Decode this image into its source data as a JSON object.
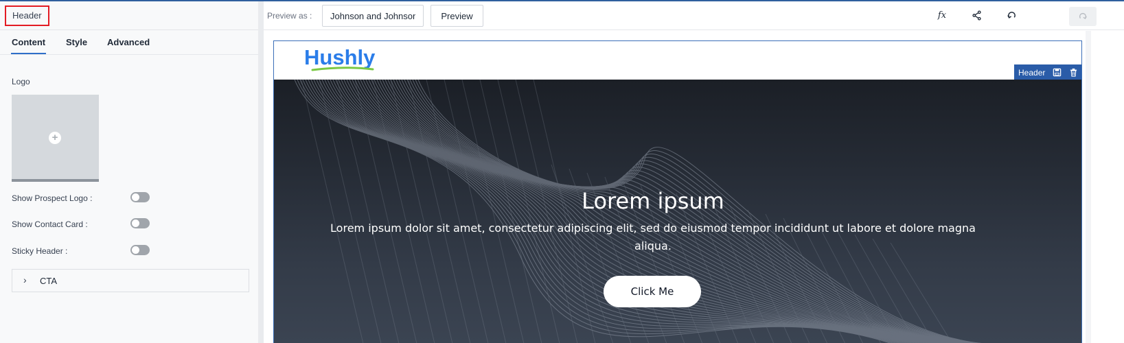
{
  "panel": {
    "title": "Header",
    "tabs": [
      {
        "label": "Content",
        "active": true
      },
      {
        "label": "Style",
        "active": false
      },
      {
        "label": "Advanced",
        "active": false
      }
    ],
    "logo_label": "Logo",
    "toggles": [
      {
        "label": "Show Prospect Logo",
        "colon": ":",
        "on": false
      },
      {
        "label": "Show Contact Card",
        "colon": ":",
        "on": false
      },
      {
        "label": "Sticky Header",
        "colon": ":",
        "on": false
      }
    ],
    "cta_section_label": "CTA"
  },
  "toolbar": {
    "preview_as_label": "Preview as :",
    "preview_as_value": "Johnson and Johnson",
    "preview_button": "Preview",
    "fx_label": "fx"
  },
  "canvas": {
    "brand_name": "Hushly",
    "header_tag_label": "Header",
    "hero_title": "Lorem ipsum",
    "hero_subtitle": "Lorem ipsum dolor sit amet, consectetur adipiscing elit, sed do eiusmod tempor incididunt ut labore et dolore magna aliqua.",
    "hero_cta": "Click Me"
  },
  "colors": {
    "accent": "#2f6fc9",
    "highlight_box": "#e31b23",
    "header_tag": "#2a5ca8",
    "brand_blue": "#2b7de9",
    "brand_green": "#7ac943"
  },
  "icons": {
    "logo_upload": "plus-icon",
    "cta_expand": "chevron-right-icon",
    "toolbar": [
      "fx-icon",
      "share-icon",
      "undo-icon",
      "redo-icon"
    ],
    "header_tag": [
      "save-icon",
      "trash-icon"
    ]
  }
}
